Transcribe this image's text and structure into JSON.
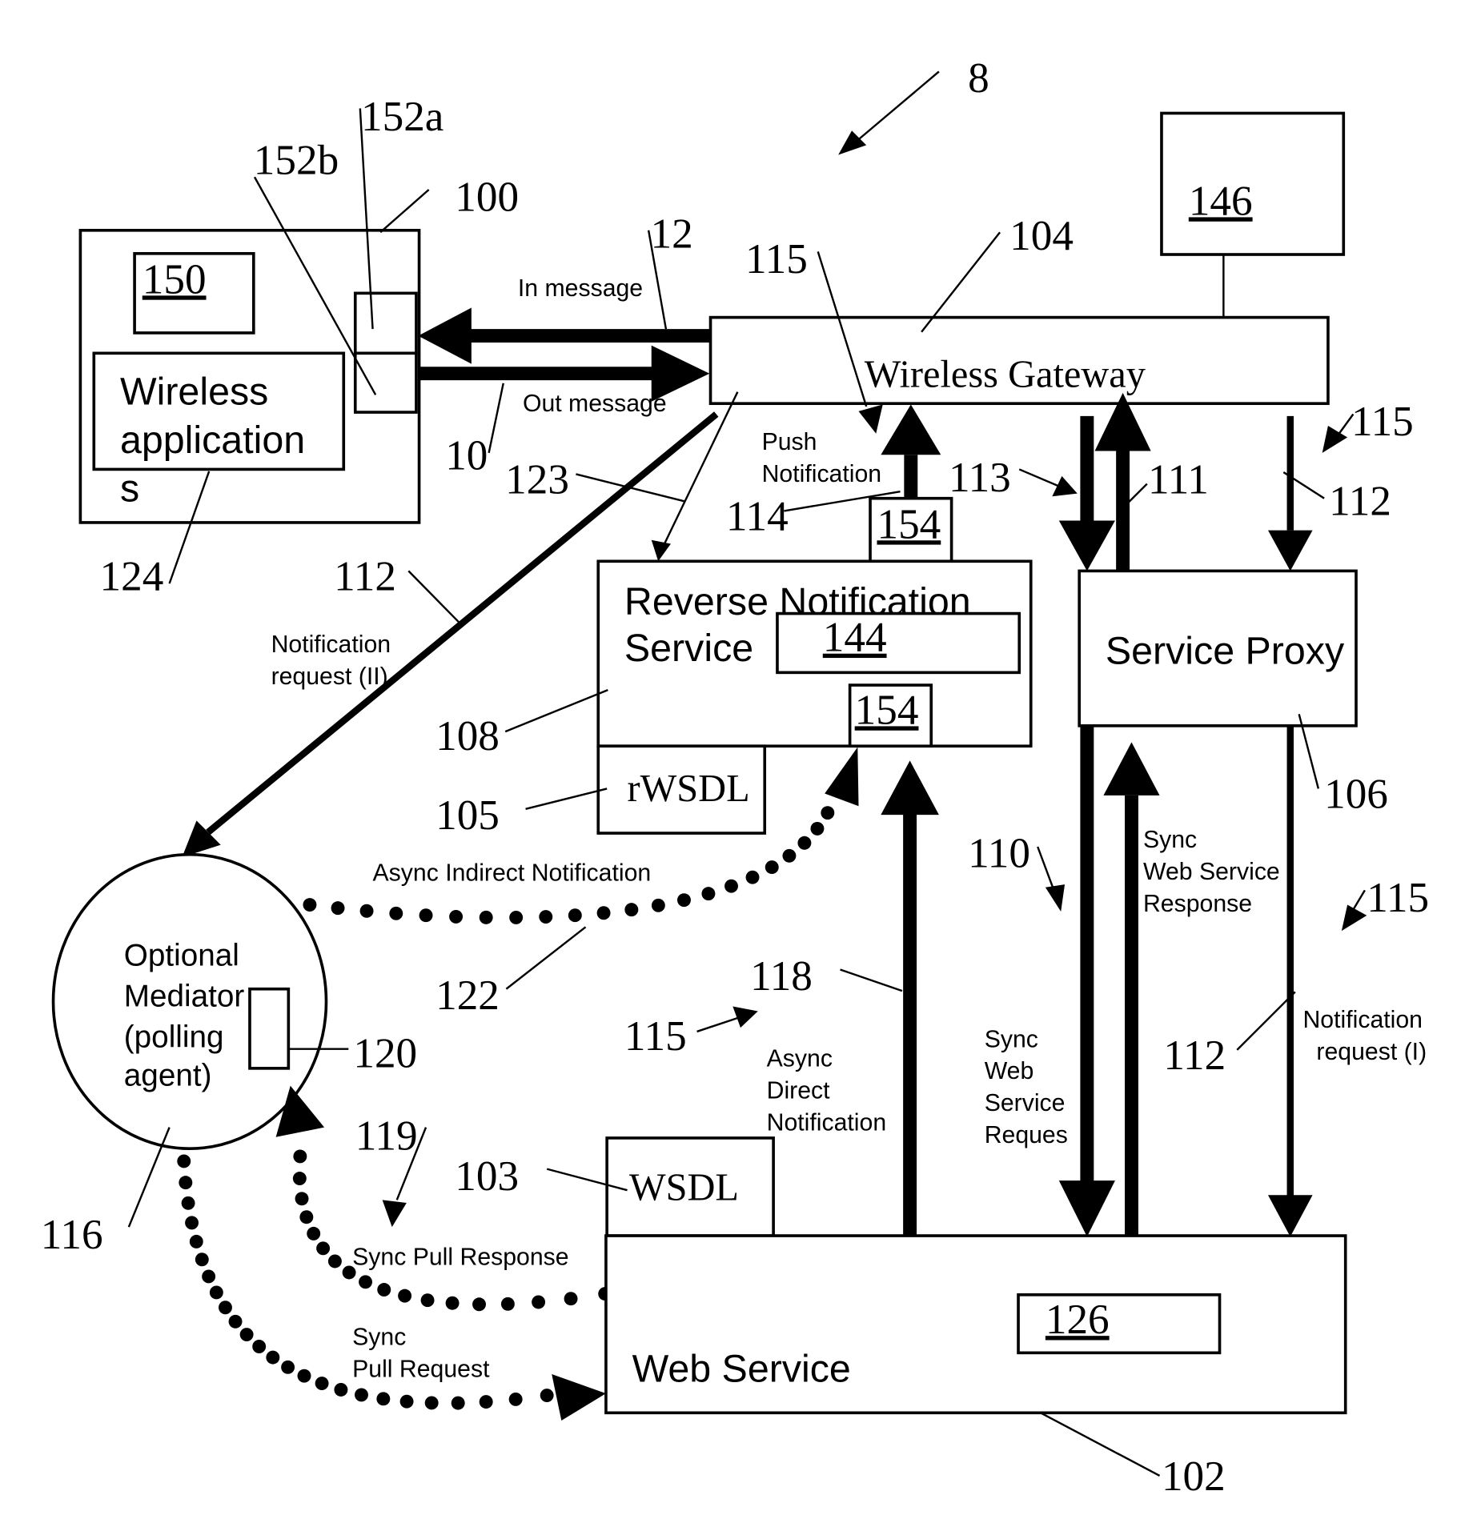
{
  "figure": {
    "ref": "8",
    "nodes": {
      "wireless_device": {
        "ref": "100",
        "app_label": "Wireless application",
        "app_label_tail": "s",
        "app_ref": "124",
        "store_ref": "150",
        "port_a_ref": "152a",
        "port_b_ref": "152b"
      },
      "wireless_gateway": {
        "label": "Wireless Gateway",
        "ref": "104"
      },
      "gateway_store": {
        "ref": "146"
      },
      "reverse_notification_service": {
        "label_line1": "Reverse Notification",
        "label_line2": "Service",
        "ref": "108",
        "inner_ref": "144",
        "notif_ref": "154",
        "top_notif_ref": "154"
      },
      "rwsdl": {
        "label": "rWSDL",
        "ref": "105"
      },
      "service_proxy": {
        "label": "Service Proxy",
        "ref": "106"
      },
      "web_service": {
        "label": "Web Service",
        "ref": "102",
        "inner_ref": "126"
      },
      "wsdl": {
        "label": "WSDL",
        "ref": "103"
      },
      "mediator": {
        "label_lines": [
          "Optional",
          "Mediator",
          "(polling",
          "agent)"
        ],
        "ref": "116",
        "inner_ref": "120"
      }
    },
    "flows": {
      "in_message": {
        "label": "In message",
        "ref": "12"
      },
      "out_message": {
        "label": "Out message",
        "ref": "10"
      },
      "push_notification": {
        "label_line1": "Push",
        "label_line2": "Notification",
        "ref": "114"
      },
      "notification_request_ii": {
        "label_line1": "Notification",
        "label_line2": "request (II)",
        "ref": "112"
      },
      "notification_request_i": {
        "label_line1": "Notification",
        "label_line2": "request (I)",
        "ref": "112"
      },
      "async_indirect": {
        "label": "Async Indirect Notification",
        "ref": "122"
      },
      "async_direct": {
        "label_lines": [
          "Async",
          "Direct",
          "Notification"
        ],
        "ref": "118"
      },
      "sync_ws_request": {
        "label_lines": [
          "Sync",
          "Web",
          "Service",
          "Reques"
        ],
        "ref": "110"
      },
      "sync_ws_response": {
        "label_lines": [
          "Sync",
          "Web Service",
          "Response"
        ],
        "ref": "111"
      },
      "sync_pull_response": {
        "label": "Sync Pull Response",
        "ref": "119"
      },
      "sync_pull_request": {
        "label_line1": "Sync",
        "label_line2": "Pull Request"
      },
      "gateway_rns_link": {
        "ref": "123"
      },
      "ref_113": "113",
      "ref_112_right": "112",
      "ref_115": "115"
    }
  }
}
